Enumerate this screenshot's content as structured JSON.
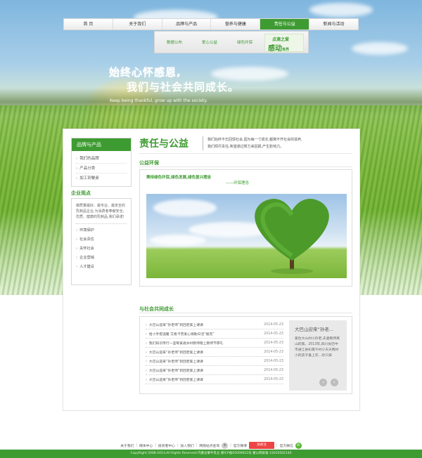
{
  "nav": {
    "items": [
      "首 页",
      "关于我们",
      "品牌与产品",
      "营养与健康",
      "责任与公益",
      "新闻与活动"
    ],
    "active_index": 4,
    "active_color": "#3e9b32"
  },
  "subnav": {
    "items": [
      "数据公布",
      "爱心公益",
      "绿色环保"
    ],
    "badge_top": "点滴之爱",
    "badge_bottom": "感动",
    "badge_world": "世界"
  },
  "hero": {
    "slogan_line1": "始终心怀感恩,",
    "slogan_line2": "我们与社会共同成长。",
    "slogan_en": "Keep being thankful, grow up with the society."
  },
  "sidebar": {
    "heading": "品牌与产品",
    "items": [
      "我们的品牌",
      "产品分类",
      "加工到餐桌"
    ],
    "section_title": "企业观点",
    "description": "做质量最好、最专业、最安全的乳制品企业,为消费者奉献安全、优质、健康的乳制品,我们承诺!",
    "links": [
      "环境保护",
      "社会责任",
      "关怀社会",
      "企业营销",
      "人才建设"
    ]
  },
  "content": {
    "title": "责任与公益",
    "quote_line1": "我们始终不忘回馈社会,因为每一寸成长,都离不开社会的滋养,",
    "quote_line2": "我们倾尽责任,希望通过努力来回报,产生影响力。",
    "section1_title": "公益环保",
    "feature_line1": "秉持绿色环保,绿色发展,绿色复兴理念",
    "feature_line2": "——环保理念",
    "section2_title": "与社会共同成长",
    "news": [
      {
        "title": "大巴山迎来“孙老师”到回老家上课课",
        "date": "2014-05-23"
      },
      {
        "title": "给小手搭温暖 艾格卡普爱心捐助日活“援克”",
        "date": "2014-05-23"
      },
      {
        "title": "我们知识传行—蓝莓爱通乡村教师赠上教师节厚礼",
        "date": "2014-05-23"
      },
      {
        "title": "大巴山迎来“孙老师”到回老家上课课",
        "date": "2014-05-23"
      },
      {
        "title": "大巴山迎来“孙老师”到回老家上课课",
        "date": "2014-05-23"
      },
      {
        "title": "大巴山迎来“孙老师”到回老家上课课",
        "date": "2014-05-23"
      },
      {
        "title": "大巴山迎来“孙老师”到回老家上课课",
        "date": "2014-05-23"
      }
    ],
    "feature_news_title": "大巴山迎来“孙老...",
    "feature_news_body": "家住大山村小孙老,夫妻教师离山的家。2013年,四川省巴中市通江县彩霞千村小天天两村小的孩子着上衣…孙只抹"
  },
  "footer": {
    "links": [
      "关于我们",
      "媒体中心",
      "投资者中心",
      "加入我们",
      "网络站点查询"
    ],
    "official_weibo": "官方微博",
    "weibo_badge": "加关注",
    "official_wechat": "官方微信",
    "copyright": "CopyRight 2008-2013,All Rights Reserved 内蒙古蒙牛乳业 蒙ICP备05000922号 蒙公网安备 15010502140"
  }
}
